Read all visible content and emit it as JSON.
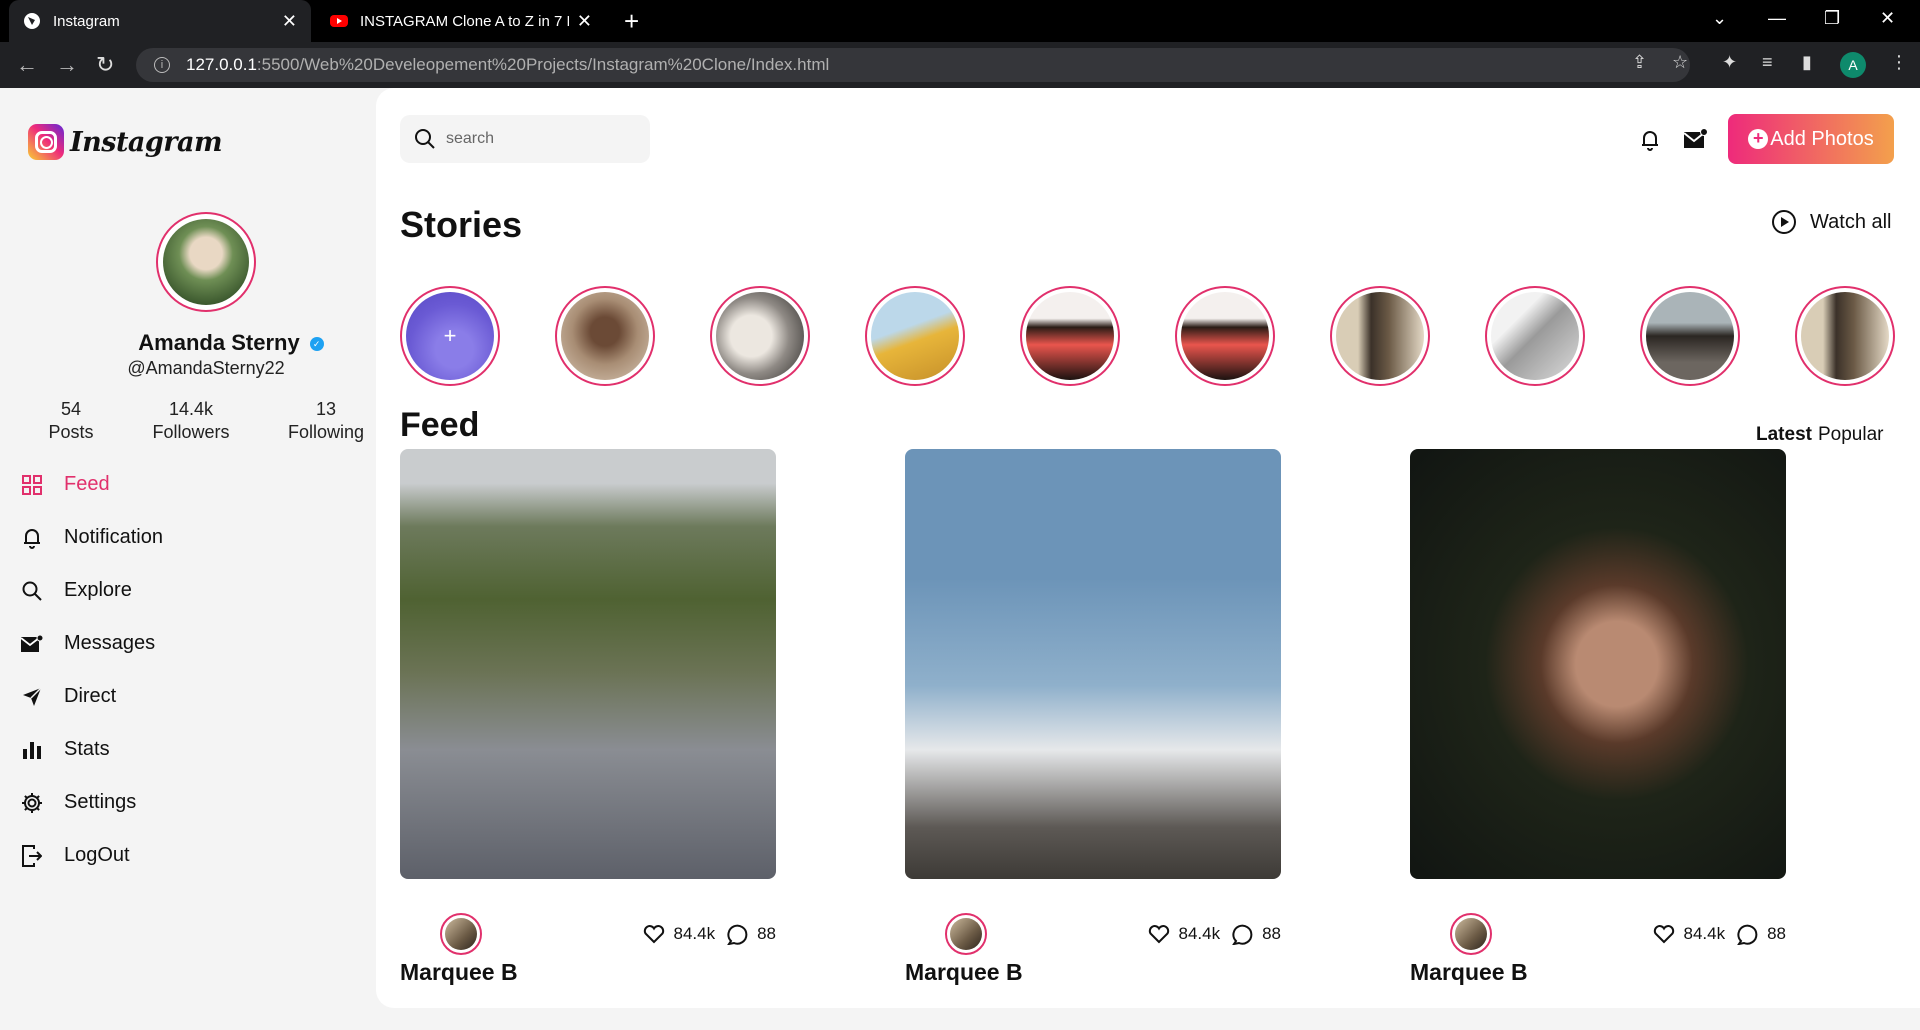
{
  "browser": {
    "tabs": [
      {
        "title": "Instagram"
      },
      {
        "title": "INSTAGRAM Clone A to Z in 7 Da"
      }
    ],
    "url_host": "127.0.0.1",
    "url_path": ":5500/Web%20Develeopement%20Projects/Instagram%20Clone/Index.html",
    "profile_initial": "A"
  },
  "sidebar": {
    "logo_text": "Instagram",
    "profile": {
      "name": "Amanda Sterny",
      "handle": "@AmandaSterny22",
      "verified": true
    },
    "stats": [
      {
        "value": "54",
        "label": "Posts"
      },
      {
        "value": "14.4k",
        "label": "Followers"
      },
      {
        "value": "13",
        "label": "Following"
      }
    ],
    "menu": [
      {
        "label": "Feed",
        "icon": "grid-icon",
        "active": true
      },
      {
        "label": "Notification",
        "icon": "bell-icon"
      },
      {
        "label": "Explore",
        "icon": "search-icon"
      },
      {
        "label": "Messages",
        "icon": "mail-icon"
      },
      {
        "label": "Direct",
        "icon": "send-icon"
      },
      {
        "label": "Stats",
        "icon": "bar-chart-icon"
      },
      {
        "label": "Settings",
        "icon": "gear-icon"
      },
      {
        "label": "LogOut",
        "icon": "logout-icon"
      }
    ]
  },
  "header": {
    "search_placeholder": "search",
    "add_photos_label": "Add Photos"
  },
  "stories": {
    "title": "Stories",
    "watch_all_label": "Watch all",
    "add_symbol": "+",
    "count": 10
  },
  "feed": {
    "title": "Feed",
    "sort": {
      "latest": "Latest",
      "popular": "Popular"
    },
    "posts": [
      {
        "author": "Marquee B",
        "likes": "84.4k",
        "comments": "88"
      },
      {
        "author": "Marquee B",
        "likes": "84.4k",
        "comments": "88"
      },
      {
        "author": "Marquee B",
        "likes": "84.4k",
        "comments": "88"
      }
    ]
  },
  "colors": {
    "accent": "#e1306c",
    "gradient_start": "#ee2a7b",
    "gradient_end": "#f3a04c"
  }
}
